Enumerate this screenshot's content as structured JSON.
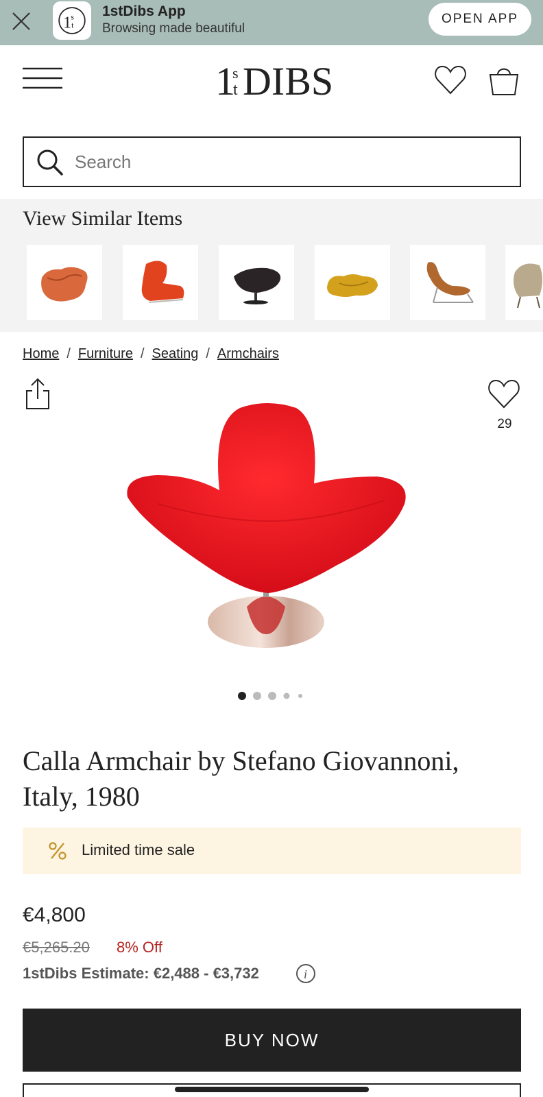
{
  "app_banner": {
    "title": "1stDibs App",
    "subtitle": "Browsing made beautiful",
    "open_label": "OPEN APP",
    "background": "#a8bdb7"
  },
  "header": {
    "logo_text": "1stDIBS",
    "icons": [
      "hamburger-menu-icon",
      "heart-icon",
      "shopping-bag-icon"
    ]
  },
  "search": {
    "placeholder": "Search",
    "value": ""
  },
  "similar": {
    "title": "View Similar Items"
  },
  "breadcrumb": [
    "Home",
    "Furniture",
    "Seating",
    "Armchairs"
  ],
  "product": {
    "favorite_count": "29",
    "title": "Calla Armchair by Stefano Giovannoni, Italy, 1980",
    "image_count": 5,
    "active_image": 1,
    "accent_color": "#e8121c"
  },
  "sale": {
    "label": "Limited time sale",
    "icon": "percent-icon",
    "background": "#fdf4e1"
  },
  "pricing": {
    "price": "€4,800",
    "old_price": "€5,265.20",
    "discount": "8% Off",
    "estimate": "1stDibs Estimate: €2,488 - €3,732",
    "discount_color": "#b4231f"
  },
  "actions": {
    "buy_now": "BUY NOW"
  }
}
